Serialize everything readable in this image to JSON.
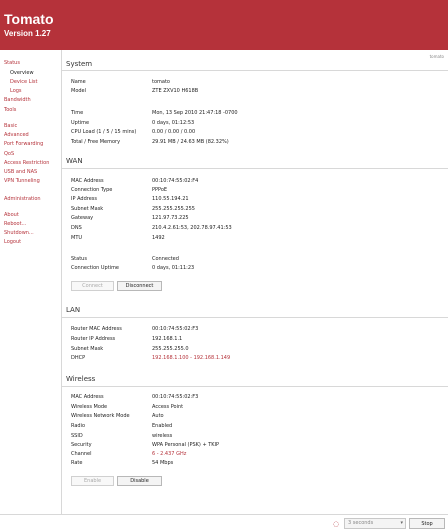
{
  "header": {
    "title": "Tomato",
    "version": "Version 1.27"
  },
  "ident": "tomato",
  "nav": [
    {
      "label": "Status",
      "sub": false,
      "selected": false
    },
    {
      "label": "Overview",
      "sub": true,
      "selected": true
    },
    {
      "label": "Device List",
      "sub": true,
      "selected": false
    },
    {
      "label": "Logs",
      "sub": true,
      "selected": false
    },
    {
      "label": "Bandwidth",
      "sub": false,
      "selected": false
    },
    {
      "label": "Tools",
      "sub": false,
      "selected": false
    },
    {
      "label": "Basic",
      "sub": false,
      "selected": false
    },
    {
      "label": "Advanced",
      "sub": false,
      "selected": false
    },
    {
      "label": "Port Forwarding",
      "sub": false,
      "selected": false
    },
    {
      "label": "QoS",
      "sub": false,
      "selected": false
    },
    {
      "label": "Access Restriction",
      "sub": false,
      "selected": false
    },
    {
      "label": "USB and NAS",
      "sub": false,
      "selected": false
    },
    {
      "label": "VPN Tunneling",
      "sub": false,
      "selected": false
    },
    {
      "label": "Administration",
      "sub": false,
      "selected": false
    },
    {
      "label": "About",
      "sub": false,
      "selected": false
    },
    {
      "label": "Reboot...",
      "sub": false,
      "selected": false
    },
    {
      "label": "Shutdown...",
      "sub": false,
      "selected": false
    },
    {
      "label": "Logout",
      "sub": false,
      "selected": false
    }
  ],
  "sections": {
    "system": {
      "title": "System",
      "rows": [
        {
          "label": "Name",
          "value": "tomato"
        },
        {
          "label": "Model",
          "value": "ZTE ZXV10 H618B"
        },
        {
          "label": "Time",
          "value": "Mon, 13 Sep 2010 21:47:18 -0700"
        },
        {
          "label": "Uptime",
          "value": "0 days, 01:12:53"
        },
        {
          "label": "CPU Load (1 / 5 / 15 mins)",
          "value": "0.00 / 0.00 / 0.00"
        },
        {
          "label": "Total / Free Memory",
          "value": "29.91 MB / 24.63 MB (82.32%)"
        }
      ]
    },
    "wan": {
      "title": "WAN",
      "rows": [
        {
          "label": "MAC Address",
          "value": "00:10:74:55:02:F4"
        },
        {
          "label": "Connection Type",
          "value": "PPPoE"
        },
        {
          "label": "IP Address",
          "value": "110.55.194.21"
        },
        {
          "label": "Subnet Mask",
          "value": "255.255.255.255"
        },
        {
          "label": "Gateway",
          "value": "121.97.73.225"
        },
        {
          "label": "DNS",
          "value": "210.4.2.61:53, 202.78.97.41:53"
        },
        {
          "label": "MTU",
          "value": "1492"
        },
        {
          "label": "Status",
          "value": "Connected"
        },
        {
          "label": "Connection Uptime",
          "value": "0 days, 01:11:23"
        }
      ],
      "buttons": {
        "connect": "Connect",
        "disconnect": "Disconnect"
      }
    },
    "lan": {
      "title": "LAN",
      "rows": [
        {
          "label": "Router MAC Address",
          "value": "00:10:74:55:02:F3"
        },
        {
          "label": "Router IP Address",
          "value": "192.168.1.1"
        },
        {
          "label": "Subnet Mask",
          "value": "255.255.255.0"
        },
        {
          "label": "DHCP",
          "value": "192.168.1.100 - 192.168.1.149"
        }
      ]
    },
    "wireless": {
      "title": "Wireless",
      "rows": [
        {
          "label": "MAC Address",
          "value": "00:10:74:55:02:F3"
        },
        {
          "label": "Wireless Mode",
          "value": "Access Point"
        },
        {
          "label": "Wireless Network Mode",
          "value": "Auto"
        },
        {
          "label": "Radio",
          "value": "Enabled"
        },
        {
          "label": "SSID",
          "value": "wireless"
        },
        {
          "label": "Security",
          "value": "WPA Personal (PSK) + TKIP"
        },
        {
          "label": "Channel",
          "value": "6 - 2.437 GHz"
        },
        {
          "label": "Rate",
          "value": "54 Mbps"
        }
      ],
      "buttons": {
        "enable": "Enable",
        "disable": "Disable"
      }
    }
  },
  "footer": {
    "refresh_interval": "3 seconds",
    "stop_label": "Stop"
  },
  "colors": {
    "header_bg": "#b5323a",
    "link": "#b5323a"
  },
  "icons": {
    "spinner": "spinner-icon",
    "dropdown": "chevron-down-icon"
  }
}
